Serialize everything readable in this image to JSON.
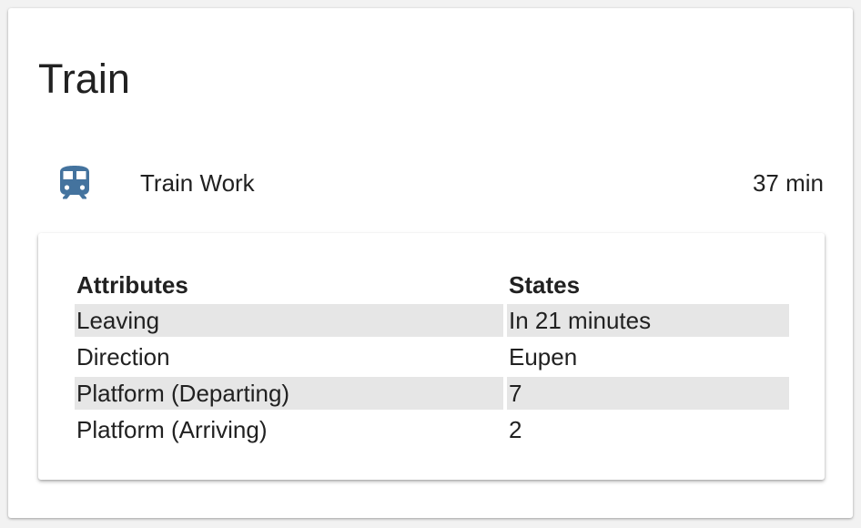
{
  "card": {
    "title": "Train"
  },
  "entity": {
    "icon": "train-icon",
    "icon_color": "#44739e",
    "name": "Train Work",
    "state": "37 min"
  },
  "attributes": {
    "header_attribute": "Attributes",
    "header_state": "States",
    "rows": [
      {
        "attribute": "Leaving",
        "state": "In 21 minutes"
      },
      {
        "attribute": "Direction",
        "state": "Eupen"
      },
      {
        "attribute": "Platform (Departing)",
        "state": "7"
      },
      {
        "attribute": "Platform (Arriving)",
        "state": "2"
      }
    ]
  }
}
